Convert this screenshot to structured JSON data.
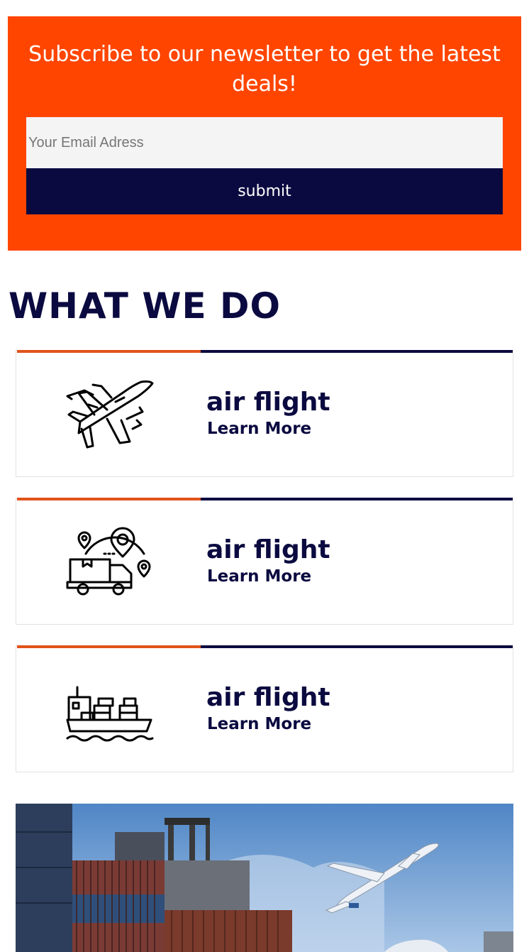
{
  "newsletter": {
    "title": "Subscribe to our newsletter to get the latest deals!",
    "email_placeholder": "Your Email Adress",
    "submit_label": "submit",
    "bg_color": "#ff4500",
    "button_color": "#0b0a40"
  },
  "what_we_do": {
    "title": "WHAT WE DO",
    "cards": [
      {
        "icon": "airplane-icon",
        "title": "air flight",
        "link": "Learn More"
      },
      {
        "icon": "delivery-truck-location-icon",
        "title": "air flight",
        "link": "Learn More"
      },
      {
        "icon": "cargo-ship-icon",
        "title": "air flight",
        "link": "Learn More"
      }
    ],
    "accent_color": "#e0531b",
    "dark_color": "#0b0a40"
  },
  "hero_image": {
    "subject": "shipping-containers-and-airplane-photo"
  }
}
